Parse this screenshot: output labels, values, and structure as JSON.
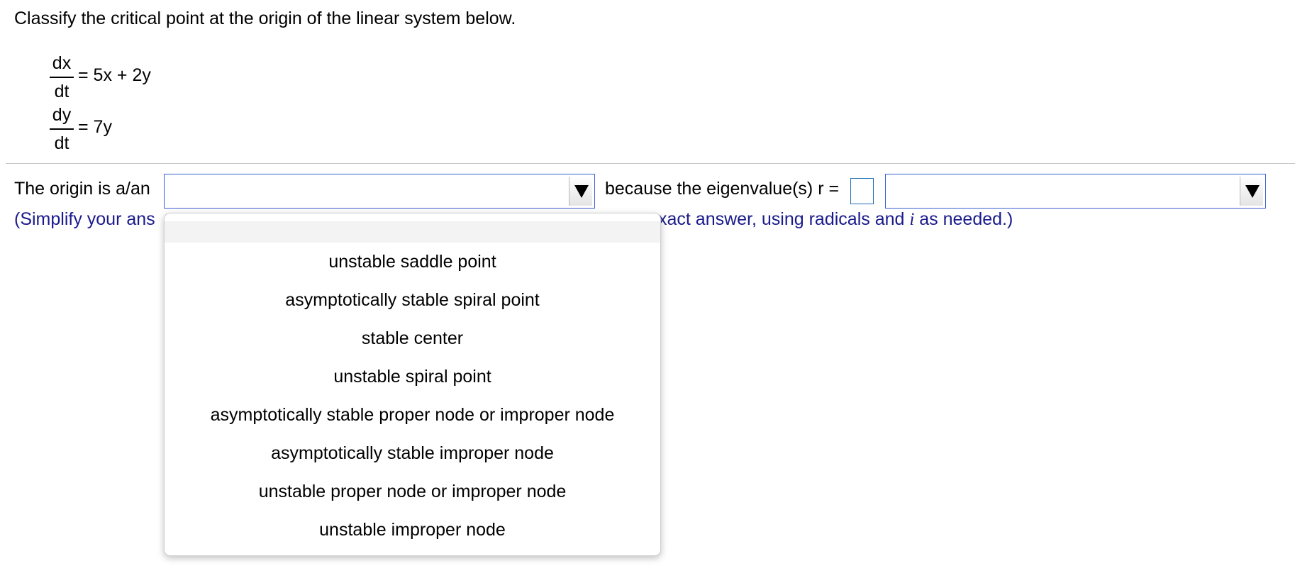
{
  "question": {
    "text": "Classify the critical point at the origin of the linear system below."
  },
  "system": {
    "eq1": {
      "numerator": "dx",
      "denominator": "dt",
      "rhs": "= 5x + 2y"
    },
    "eq2": {
      "numerator": "dy",
      "denominator": "dt",
      "rhs": "= 7y"
    }
  },
  "answer": {
    "prefix": "The origin is a/an",
    "middle": "because the eigenvalue(s) r =",
    "classification_value": "",
    "eigenvalue_value": "",
    "reason_value": ""
  },
  "instruction": {
    "left": "(Simplify your ans",
    "right_pre": "xact answer, using radicals and ",
    "right_var": "i",
    "right_post": " as needed.)"
  },
  "dropdown": {
    "options": [
      "unstable saddle point",
      "asymptotically stable spiral point",
      "stable center",
      "unstable spiral point",
      "asymptotically stable proper node or improper node",
      "asymptotically stable improper node",
      "unstable proper node or improper node",
      "unstable improper node"
    ]
  }
}
